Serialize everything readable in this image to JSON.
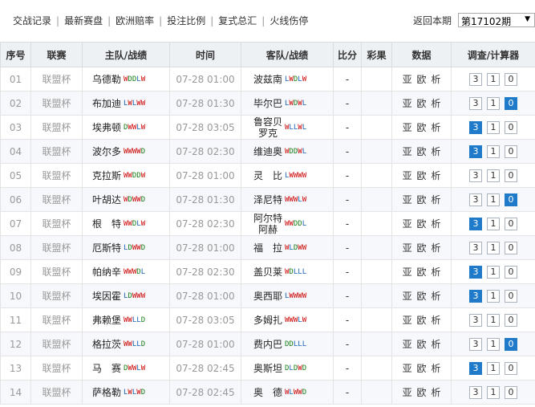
{
  "nav": [
    "交战记录",
    "最新赛盘",
    "欧洲赔率",
    "投注比例",
    "复式总汇",
    "火线伤停"
  ],
  "period": {
    "label": "返回本期",
    "selected": "第17102期"
  },
  "headers": [
    "序号",
    "联赛",
    "主队/战绩",
    "时间",
    "客队/战绩",
    "比分",
    "彩果",
    "数据",
    "调查/计算器"
  ],
  "data_links": [
    "亚",
    "欧",
    "析"
  ],
  "colors": {
    "win": "#c00000",
    "draw": "#1a7f1a",
    "loss": "#1c63b7",
    "active_box": "#1f7ac9"
  },
  "rows": [
    {
      "num": "01",
      "league": "联盟杯",
      "home": "乌德勒",
      "home_form": "WDDLW",
      "time": "07-28 01:00",
      "away": "波兹南",
      "away_form": "LWDLW",
      "score": "-",
      "result": "",
      "calc": [
        "3",
        "1",
        "0"
      ],
      "active": []
    },
    {
      "num": "02",
      "league": "联盟杯",
      "home": "布加迪",
      "home_form": "LWLWW",
      "time": "07-28 01:30",
      "away": "毕尔巴",
      "away_form": "LWDWL",
      "score": "-",
      "result": "",
      "calc": [
        "3",
        "1",
        "0"
      ],
      "active": [
        2
      ]
    },
    {
      "num": "03",
      "league": "联盟杯",
      "home": "埃弗顿",
      "home_form": "DWWLW",
      "time": "07-28 03:05",
      "away": "鲁容贝罗克",
      "away_form": "WLLWL",
      "score": "-",
      "result": "",
      "calc": [
        "3",
        "1",
        "0"
      ],
      "active": [
        0
      ]
    },
    {
      "num": "04",
      "league": "联盟杯",
      "home": "波尔多",
      "home_form": "WWWWD",
      "time": "07-28 02:30",
      "away": "维迪奥",
      "away_form": "WDDWL",
      "score": "-",
      "result": "",
      "calc": [
        "3",
        "1",
        "0"
      ],
      "active": [
        0
      ]
    },
    {
      "num": "05",
      "league": "联盟杯",
      "home": "克拉斯",
      "home_form": "WWDDW",
      "time": "07-28 01:00",
      "away": "灵　比",
      "away_form": "LWWWW",
      "score": "-",
      "result": "",
      "calc": [
        "3",
        "1",
        "0"
      ],
      "active": []
    },
    {
      "num": "06",
      "league": "联盟杯",
      "home": "叶胡达",
      "home_form": "WDWWD",
      "time": "07-28 01:30",
      "away": "泽尼特",
      "away_form": "WWWLW",
      "score": "-",
      "result": "",
      "calc": [
        "3",
        "1",
        "0"
      ],
      "active": [
        2
      ]
    },
    {
      "num": "07",
      "league": "联盟杯",
      "home": "根　特",
      "home_form": "WWDLW",
      "time": "07-28 02:30",
      "away": "阿尔特阿赫",
      "away_form": "WWDDL",
      "score": "-",
      "result": "",
      "calc": [
        "3",
        "1",
        "0"
      ],
      "active": [
        0
      ]
    },
    {
      "num": "08",
      "league": "联盟杯",
      "home": "厄斯特",
      "home_form": "LDWWD",
      "time": "07-28 01:00",
      "away": "福　拉",
      "away_form": "WLDWW",
      "score": "-",
      "result": "",
      "calc": [
        "3",
        "1",
        "0"
      ],
      "active": []
    },
    {
      "num": "09",
      "league": "联盟杯",
      "home": "帕纳辛",
      "home_form": "WWWDL",
      "time": "07-28 02:30",
      "away": "盖贝莱",
      "away_form": "WDLLL",
      "score": "-",
      "result": "",
      "calc": [
        "3",
        "1",
        "0"
      ],
      "active": [
        0
      ]
    },
    {
      "num": "10",
      "league": "联盟杯",
      "home": "埃因霍",
      "home_form": "LDWWW",
      "time": "07-28 01:00",
      "away": "奥西耶",
      "away_form": "LWWWW",
      "score": "-",
      "result": "",
      "calc": [
        "3",
        "1",
        "0"
      ],
      "active": [
        0
      ]
    },
    {
      "num": "11",
      "league": "联盟杯",
      "home": "弗赖堡",
      "home_form": "WWLLD",
      "time": "07-28 03:05",
      "away": "多姆扎",
      "away_form": "WWWLW",
      "score": "-",
      "result": "",
      "calc": [
        "3",
        "1",
        "0"
      ],
      "active": []
    },
    {
      "num": "12",
      "league": "联盟杯",
      "home": "格拉茨",
      "home_form": "WWLLD",
      "time": "07-28 01:00",
      "away": "费内巴",
      "away_form": "DDLLL",
      "score": "-",
      "result": "",
      "calc": [
        "3",
        "1",
        "0"
      ],
      "active": [
        2
      ]
    },
    {
      "num": "13",
      "league": "联盟杯",
      "home": "马　赛",
      "home_form": "DWWLW",
      "time": "07-28 02:45",
      "away": "奥斯坦",
      "away_form": "DLDWD",
      "score": "-",
      "result": "",
      "calc": [
        "3",
        "1",
        "0"
      ],
      "active": [
        0
      ]
    },
    {
      "num": "14",
      "league": "联盟杯",
      "home": "萨格勒",
      "home_form": "LWLWD",
      "time": "07-28 02:45",
      "away": "奥　德",
      "away_form": "WLWWD",
      "score": "-",
      "result": "",
      "calc": [
        "3",
        "1",
        "0"
      ],
      "active": []
    }
  ]
}
